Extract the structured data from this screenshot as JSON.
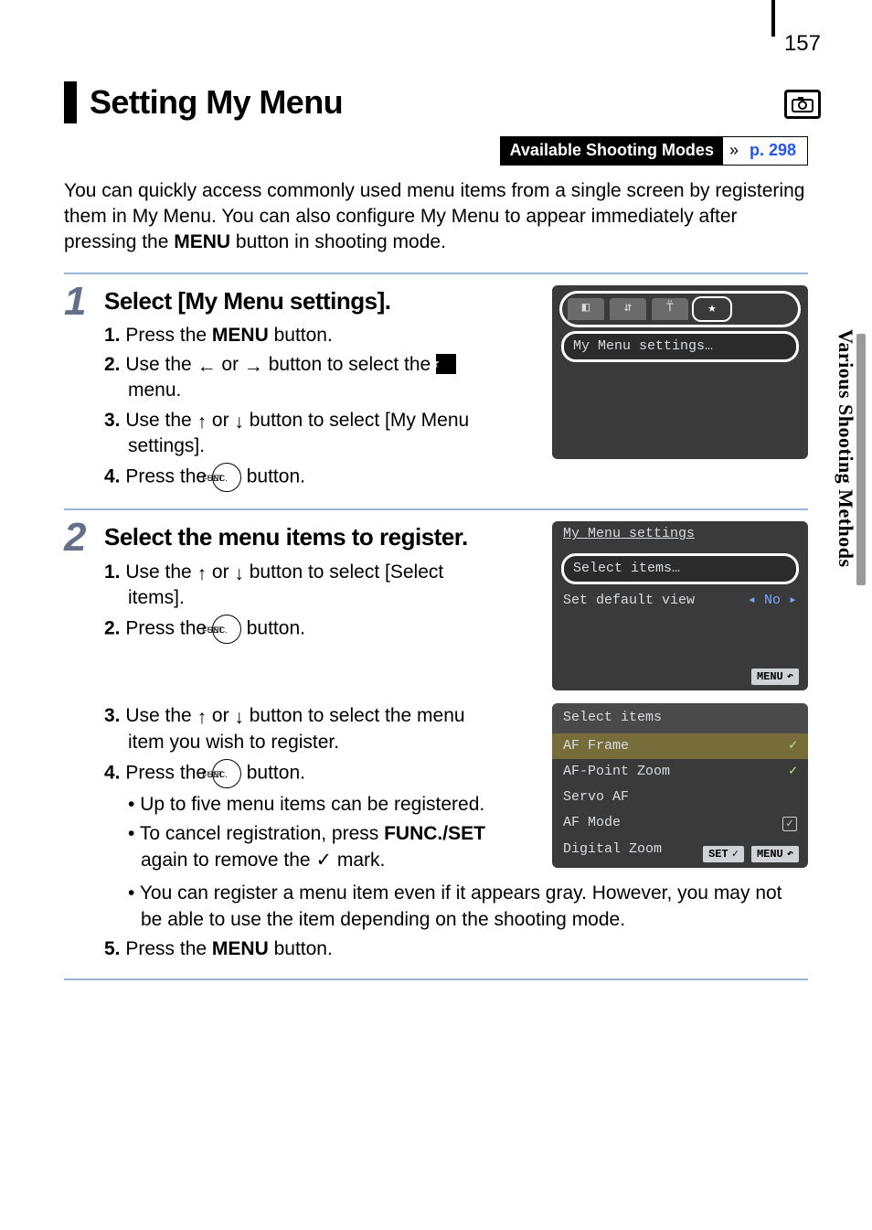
{
  "page_number": "157",
  "side_tab": "Various Shooting Methods",
  "title": "Setting My Menu",
  "modes": {
    "label": "Available Shooting Modes",
    "ref": "p. 298"
  },
  "intro": {
    "p1a": "You can quickly access commonly used menu items from a single screen by registering them in My Menu. You can also configure My Menu to appear immediately after pressing the ",
    "p1b": "MENU",
    "p1c": " button in shooting mode."
  },
  "step1": {
    "title": "Select [My Menu settings].",
    "l1a": "1.",
    "l1b": " Press the ",
    "l1c": "MENU",
    "l1d": " button.",
    "l2a": "2.",
    "l2b": " Use the ",
    "l2c": " or ",
    "l2d": " button to select the ",
    "l2e": " menu.",
    "l3a": "3.",
    "l3b": " Use the ",
    "l3c": " or ",
    "l3d": " button to select [My Menu settings].",
    "l4a": "4.",
    "l4b": " Press the ",
    "l4c": " button."
  },
  "lcd1": {
    "item": "My Menu settings…"
  },
  "step2": {
    "title": "Select the menu items to register.",
    "l1a": "1.",
    "l1b": " Use the ",
    "l1c": " or ",
    "l1d": " button to select [Select items].",
    "l2a": "2.",
    "l2b": " Press the ",
    "l2c": " button.",
    "l3a": "3.",
    "l3b": " Use the ",
    "l3c": " or ",
    "l3d": " button to select the menu item you wish to register.",
    "l4a": "4.",
    "l4b": " Press the ",
    "l4c": " button.",
    "b1": "Up to five menu items can be registered.",
    "b2a": "To cancel registration, press ",
    "b2b": "FUNC./SET",
    "b2c": " again to remove the ✓ mark.",
    "b3": "You can register a menu item even if it appears gray. However, you may not be able to use the item depending on the shooting mode.",
    "l5a": "5.",
    "l5b": " Press the ",
    "l5c": "MENU",
    "l5d": " button."
  },
  "lcd2": {
    "title": "My Menu settings",
    "sel": "Select items…",
    "row2a": "Set default view",
    "row2b": "No",
    "menu_btn": "MENU"
  },
  "lcd3": {
    "title": "Select items",
    "r1": "AF Frame",
    "r2": "AF-Point Zoom",
    "r3": "Servo AF",
    "r4": "AF Mode",
    "r5": "Digital Zoom",
    "set_btn": "SET",
    "menu_btn": "MENU"
  },
  "func_label_top": "FUNC.",
  "func_label_bot": "SET",
  "star": "★",
  "chev": "»"
}
